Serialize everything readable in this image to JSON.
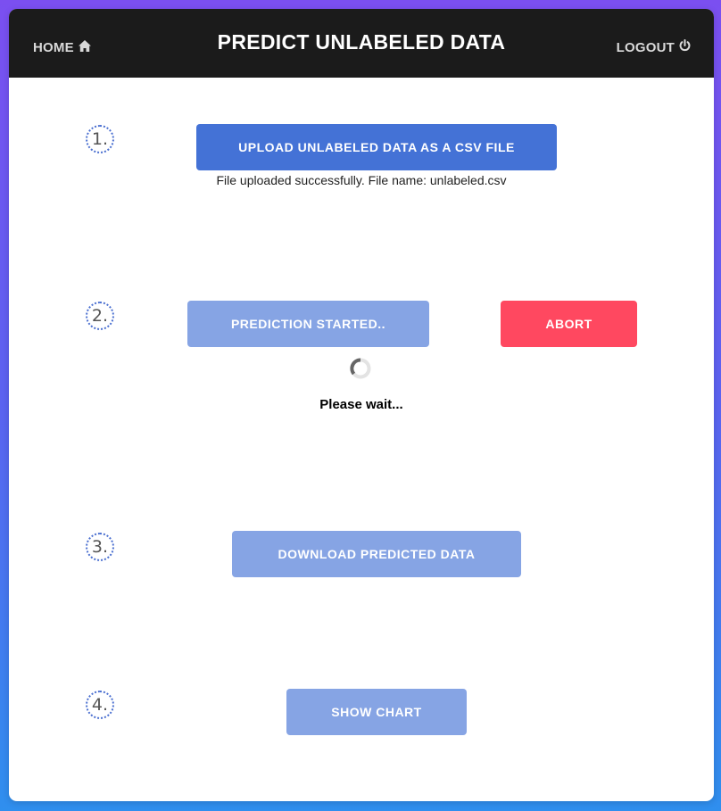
{
  "header": {
    "home_label": "HOME",
    "title": "PREDICT UNLABELED DATA",
    "logout_label": "LOGOUT"
  },
  "steps": [
    {
      "number": "1."
    },
    {
      "number": "2."
    },
    {
      "number": "3."
    },
    {
      "number": "4."
    }
  ],
  "upload": {
    "button_label": "UPLOAD UNLABELED DATA AS A CSV FILE",
    "status": "File uploaded successfully. File name: unlabeled.csv"
  },
  "predict": {
    "button_label": "PREDICTION STARTED..",
    "abort_label": "ABORT",
    "wait_text": "Please wait..."
  },
  "download": {
    "button_label": "DOWNLOAD PREDICTED DATA"
  },
  "chart": {
    "button_label": "SHOW CHART"
  },
  "colors": {
    "primary": "#4472d6",
    "faded": "#86a4e4",
    "danger": "#ff4860",
    "header_bg": "#1b1b1b"
  }
}
